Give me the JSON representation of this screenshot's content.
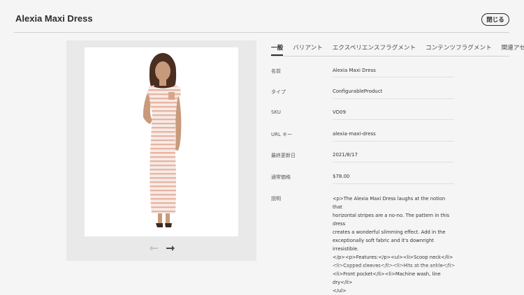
{
  "header": {
    "title": "Alexia Maxi Dress",
    "close_label": "閉じる"
  },
  "tabs": [
    {
      "label": "一般",
      "active": true
    },
    {
      "label": "バリアント"
    },
    {
      "label": "エクスペリエンスフラグメント"
    },
    {
      "label": "コンテンツフラグメント"
    },
    {
      "label": "関連アセット"
    }
  ],
  "fields": [
    {
      "label": "名前",
      "value": "Alexia Maxi Dress"
    },
    {
      "label": "タイプ",
      "value": "ConfigurableProduct"
    },
    {
      "label": "SKU",
      "value": "VD09"
    },
    {
      "label": "URL キー",
      "value": "alexia-maxi-dress"
    },
    {
      "label": "最終更新日",
      "value": "2021/8/17"
    },
    {
      "label": "通常価格",
      "value": "$78.00"
    },
    {
      "label": "説明",
      "value": "<p>The Alexia Maxi Dress laughs at the notion that\nhorizontal stripes are a no-no. The pattern in this dress\ncreates a wonderful slimming effect. Add in the\nexceptionally soft fabric and it's downright irresistible.\n</p><p>Features:</p><ul><li>Scoop neck</li>\n<li>Capped sleeves</li><li>Hits at the ankle</li>\n<li>Front pocket</li><li>Machine wash, line dry</li>\n</ul>"
    }
  ],
  "colors": {
    "background": "#f5f5f5",
    "text": "#2c2c2c",
    "dress_stripe": "#e8b8a8"
  },
  "icons": {
    "prev": "arrow-left-icon",
    "next": "arrow-right-icon"
  }
}
